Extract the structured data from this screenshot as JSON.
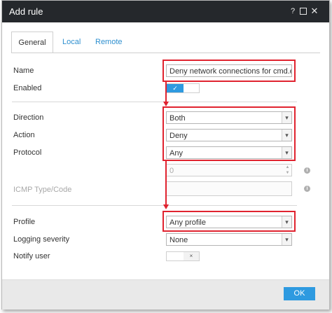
{
  "window": {
    "title": "Add rule",
    "help_glyph": "?",
    "close_glyph": "✕"
  },
  "tabs": [
    "General",
    "Local",
    "Remote"
  ],
  "form": {
    "name_label": "Name",
    "name_value": "Deny network connections for cmd.exe (n",
    "enabled_label": "Enabled",
    "enabled_on": true,
    "enabled_glyph": "✓",
    "direction_label": "Direction",
    "direction_value": "Both",
    "action_label": "Action",
    "action_value": "Deny",
    "protocol_label": "Protocol",
    "protocol_value": "Any",
    "port_value": "0",
    "icmp_label": "ICMP Type/Code",
    "profile_label": "Profile",
    "profile_value": "Any profile",
    "logging_label": "Logging severity",
    "logging_value": "None",
    "notify_label": "Notify user",
    "notify_on": false,
    "notify_glyph": "×",
    "caret_glyph": "▾",
    "spin_up": "▲",
    "spin_down": "▼",
    "info_glyph": "i"
  },
  "footer": {
    "ok_label": "OK"
  },
  "colors": {
    "titlebar": "#25282c",
    "accent": "#2e9ae0",
    "highlight": "#e0232f"
  }
}
